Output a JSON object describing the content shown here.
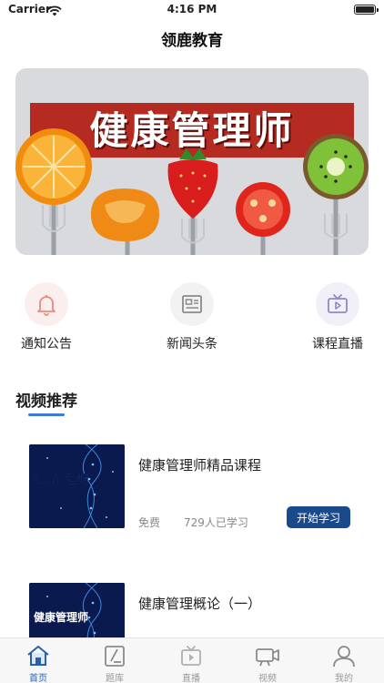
{
  "status_bar": {
    "carrier": "Carrier",
    "time": "4:16 PM"
  },
  "nav": {
    "title": "领鹿教育"
  },
  "banner": {
    "text": "健康管理师"
  },
  "quick_menu": [
    {
      "label": "通知公告",
      "icon": "bell-icon",
      "color": "#e88a7c"
    },
    {
      "label": "新闻头条",
      "icon": "newspaper-icon",
      "color": "#8a8a8a"
    },
    {
      "label": "课程直播",
      "icon": "live-video-icon",
      "color": "#8f88c8"
    }
  ],
  "section": {
    "title": "视频推荐"
  },
  "courses": [
    {
      "title": "健康管理师精品课程",
      "price": "免费",
      "learners": "729人已学习",
      "button": "开始学习",
      "thumb_text": "健康管理师"
    },
    {
      "title": "健康管理概论（一）",
      "thumb_text": "健康管理师"
    }
  ],
  "tabs": [
    {
      "label": "首页",
      "icon": "home-icon",
      "active": true
    },
    {
      "label": "题库",
      "icon": "question-bank-icon",
      "active": false
    },
    {
      "label": "直播",
      "icon": "live-icon",
      "active": false
    },
    {
      "label": "视频",
      "icon": "video-camera-icon",
      "active": false
    },
    {
      "label": "我的",
      "icon": "profile-icon",
      "active": false
    }
  ],
  "colors": {
    "accent": "#3b7be0",
    "button": "#1a4a8c",
    "tab_active": "#2d5fa8"
  }
}
